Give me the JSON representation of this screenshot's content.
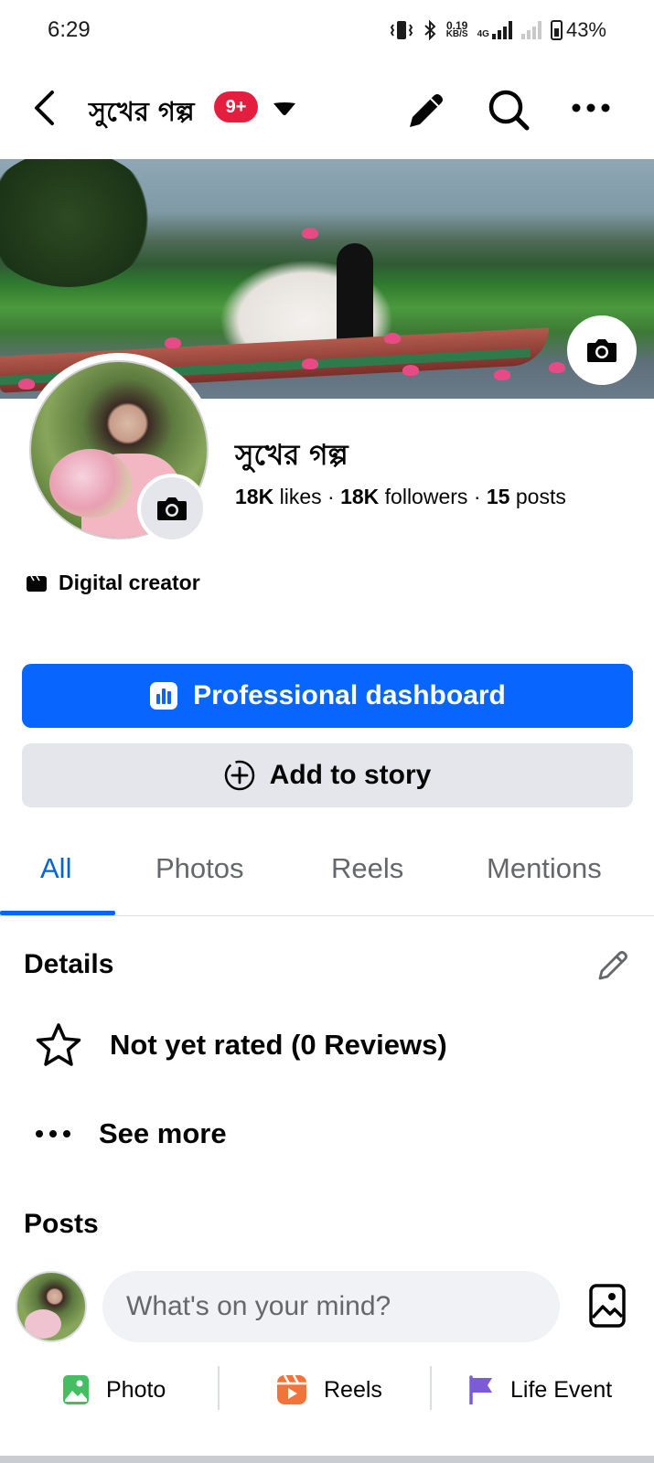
{
  "status_bar": {
    "time": "6:29",
    "net_speed_value": "0.19",
    "net_speed_unit": "KB/S",
    "network_type": "4G",
    "battery": "43%"
  },
  "nav": {
    "title": "সুখের গল্প",
    "badge": "9+"
  },
  "profile": {
    "name": "সুখের গল্প",
    "likes_count": "18K",
    "likes_label": "likes",
    "followers_count": "18K",
    "followers_label": "followers",
    "posts_count": "15",
    "posts_label": "posts",
    "separator": "·",
    "category": "Digital creator"
  },
  "buttons": {
    "professional_dashboard": "Professional dashboard",
    "add_to_story": "Add to story"
  },
  "tabs": [
    {
      "label": "All",
      "active": true
    },
    {
      "label": "Photos",
      "active": false
    },
    {
      "label": "Reels",
      "active": false
    },
    {
      "label": "Mentions",
      "active": false
    }
  ],
  "details": {
    "title": "Details",
    "rating": "Not yet rated (0 Reviews)",
    "see_more": "See more"
  },
  "posts": {
    "title": "Posts",
    "composer_placeholder": "What's on your mind?",
    "actions": [
      {
        "label": "Photo",
        "icon": "photo-icon"
      },
      {
        "label": "Reels",
        "icon": "reels-icon"
      },
      {
        "label": "Life Event",
        "icon": "flag-icon"
      }
    ]
  },
  "colors": {
    "primary": "#0866ff",
    "badge": "#e41e3f",
    "tab_active": "#0064d1",
    "photo_green": "#45bd62",
    "reels_orange": "#f3743a",
    "flag_purple": "#7c5bd6"
  }
}
